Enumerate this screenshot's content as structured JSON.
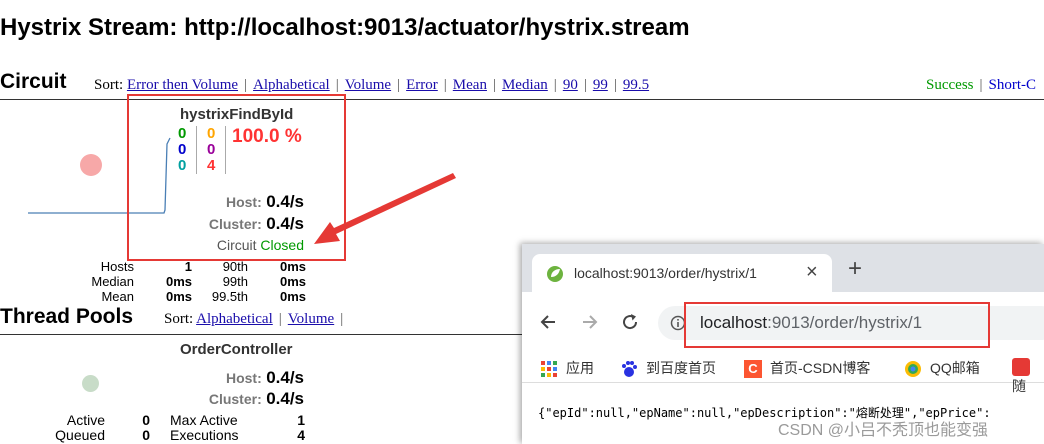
{
  "header": {
    "title": "Hystrix Stream: http://localhost:9013/actuator/hystrix.stream"
  },
  "circuit": {
    "title": "Circuit",
    "sort_label": "Sort:",
    "sort_options": [
      "Error then Volume",
      "Alphabetical",
      "Volume",
      "Error",
      "Mean",
      "Median",
      "90",
      "99",
      "99.5"
    ],
    "legend": {
      "success": "Success",
      "short": "Short-C"
    },
    "card": {
      "name": "hystrixFindById",
      "counts_col1": [
        "0",
        "0",
        "0"
      ],
      "counts_col2": [
        "0",
        "0",
        "4"
      ],
      "error_rate": "100.0 %",
      "host_label": "Host:",
      "host_value": "0.4/s",
      "cluster_label": "Cluster:",
      "cluster_value": "0.4/s",
      "circuit_label": "Circuit",
      "circuit_status": "Closed",
      "stats": {
        "hosts_label": "Hosts",
        "hosts_value": "1",
        "median_label": "Median",
        "median_value": "0ms",
        "mean_label": "Mean",
        "mean_value": "0ms",
        "p90_label": "90th",
        "p90_value": "0ms",
        "p99_label": "99th",
        "p99_value": "0ms",
        "p995_label": "99.5th",
        "p995_value": "0ms"
      }
    }
  },
  "thread_pools": {
    "title": "Thread Pools",
    "sort_label": "Sort:",
    "sort_options": [
      "Alphabetical",
      "Volume"
    ],
    "card": {
      "name": "OrderController",
      "host_label": "Host:",
      "host_value": "0.4/s",
      "cluster_label": "Cluster:",
      "cluster_value": "0.4/s",
      "active_label": "Active",
      "active_value": "0",
      "queued_label": "Queued",
      "queued_value": "0",
      "max_active_label": "Max Active",
      "max_active_value": "1",
      "executions_label": "Executions",
      "executions_value": "4"
    }
  },
  "browser": {
    "tab_title": "localhost:9013/order/hystrix/1",
    "tab_close": "×",
    "new_tab": "+",
    "url_host": "localhost",
    "url_rest": ":9013/order/hystrix/1",
    "bookmarks": [
      "应用",
      "到百度首页",
      "首页-CSDN博客",
      "QQ邮箱",
      "随"
    ],
    "body_text": "{\"epId\":null,\"epName\":null,\"epDescription\":\"熔断处理\",\"epPrice\":"
  },
  "watermark": "CSDN @小吕不秃顶也能变强",
  "colors": {
    "success": "#009900",
    "blue": "#0000cc",
    "cyan": "#00a0a0",
    "orange": "#ffa500",
    "purple": "#990099",
    "red": "#ff3333",
    "annotation": "#e53935"
  }
}
